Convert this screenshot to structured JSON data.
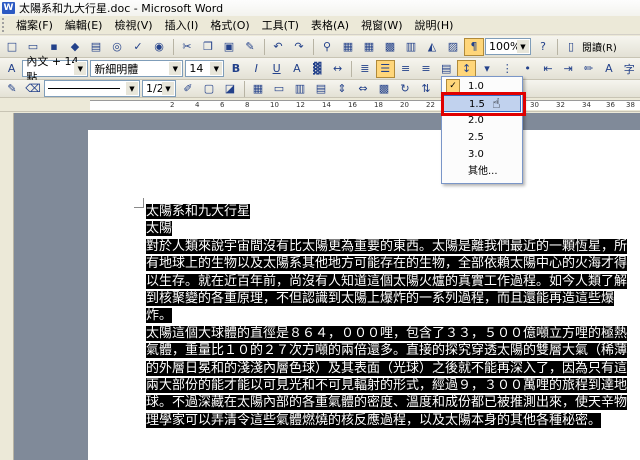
{
  "window": {
    "title": "太陽系和九大行星.doc - Microsoft Word",
    "app_icon": "W"
  },
  "menu": [
    "檔案(F)",
    "編輯(E)",
    "檢視(V)",
    "插入(I)",
    "格式(O)",
    "工具(T)",
    "表格(A)",
    "視窗(W)",
    "說明(H)"
  ],
  "toolbar_standard": {
    "zoom": "100%",
    "reading_label": "閱讀(R)"
  },
  "toolbar_formatting": {
    "style": "內文 + 14 點",
    "font": "新細明體",
    "size": "14",
    "bold": "B",
    "italic": "I",
    "underline": "U",
    "char_a": "A"
  },
  "toolbar_drawing": {
    "page_ratio": "1/2"
  },
  "ruler": {
    "ticks": [
      "2",
      "4",
      "6",
      "8",
      "10",
      "12",
      "14",
      "16",
      "18",
      "20",
      "22",
      "24",
      "26",
      "28",
      "30",
      "32",
      "34",
      "36",
      "38"
    ]
  },
  "line_spacing_menu": {
    "items": [
      "1.0",
      "1.5",
      "2.0",
      "2.5",
      "3.0",
      "其他..."
    ],
    "checked_item": "1.0",
    "highlighted_item": "1.5"
  },
  "document": {
    "paragraphs": [
      "太陽系和九大行星",
      "太陽",
      "對於人類來說宇宙間沒有比太陽更為重要的東西。太陽是離我們最近的一顆恆星，所有地球上的生物以及太陽系其他地方可能存在的生物，全部依賴太陽中心的火海才得以生存。就在近百年前，尚沒有人知道這個太陽火爐的真實工作過程。如今人類了解到核聚變的各重原理，不但認識到太陽上爆炸的一系列過程，而且還能再造這些爆炸。",
      "太陽這個大球體的直徑是８６４，０００哩，包含了３３，５００億噸立方哩的極熱氣體，重量比１０的２７次方噸的兩倍還多。直接的探究穿透太陽的雙層大氣（稀薄的外層日冕和的淺淺內層色球）及其表面（光球）之後就不能再深入了，因為只有這兩大部份的能才能以可見光和不可見輻射的形式，經過９，３００萬哩的旅程到達地球。不過深藏在太陽內部的各重氣體的密度、溫度和成份都已被推測出來，使天辛物理學家可以弄清令這些氣體燃燒的核反應過程，以及太陽本身的其他各種秘密。"
    ]
  }
}
